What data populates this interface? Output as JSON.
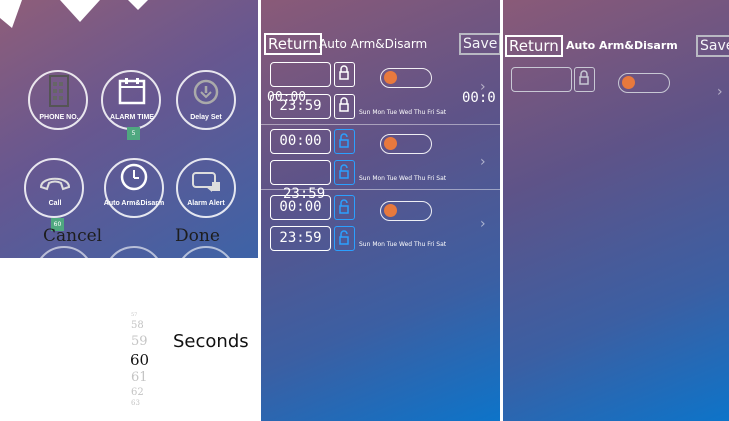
{
  "menu": {
    "items": [
      {
        "label": "PHONE NO.",
        "icon": "phone-book-icon"
      },
      {
        "label": "ALARM TIME",
        "icon": "calendar-icon",
        "badge": "5"
      },
      {
        "label": "Delay Set",
        "icon": "timer-icon"
      },
      {
        "label": "Call",
        "icon": "handset-icon",
        "badge": "60"
      },
      {
        "label": "Auto Arm&Disarm",
        "icon": "clock-icon"
      },
      {
        "label": "Alarm Alert",
        "icon": "alert-speaker-icon"
      }
    ]
  },
  "picker": {
    "cancel_label": "Cancel",
    "done_label": "Done",
    "unit_label": "Seconds",
    "wheel": [
      "57",
      "58",
      "59",
      "60",
      "61",
      "62",
      "63"
    ],
    "selected": "60"
  },
  "arm_list": {
    "return_label": "Return",
    "title": "Auto Arm&Disarm",
    "save_label": "Save",
    "days": "Sun Mon Tue Wed Thu Fri Sat",
    "overlay_time_left": "00:00",
    "overlay_time_right": "00:0",
    "groups": [
      {
        "start": "",
        "end": "23:59"
      },
      {
        "start": "00:00",
        "end": ""
      },
      {
        "start": "00:00",
        "end": "23:59",
        "overlay": "23:59"
      }
    ]
  },
  "arm_single": {
    "return_label": "Return",
    "title": "Auto Arm&Disarm",
    "save_label": "Save",
    "start": ""
  },
  "colors": {
    "toggle_knob": "#e8793d",
    "badge": "#4fa880",
    "lock_active": "#2ba0ff"
  }
}
